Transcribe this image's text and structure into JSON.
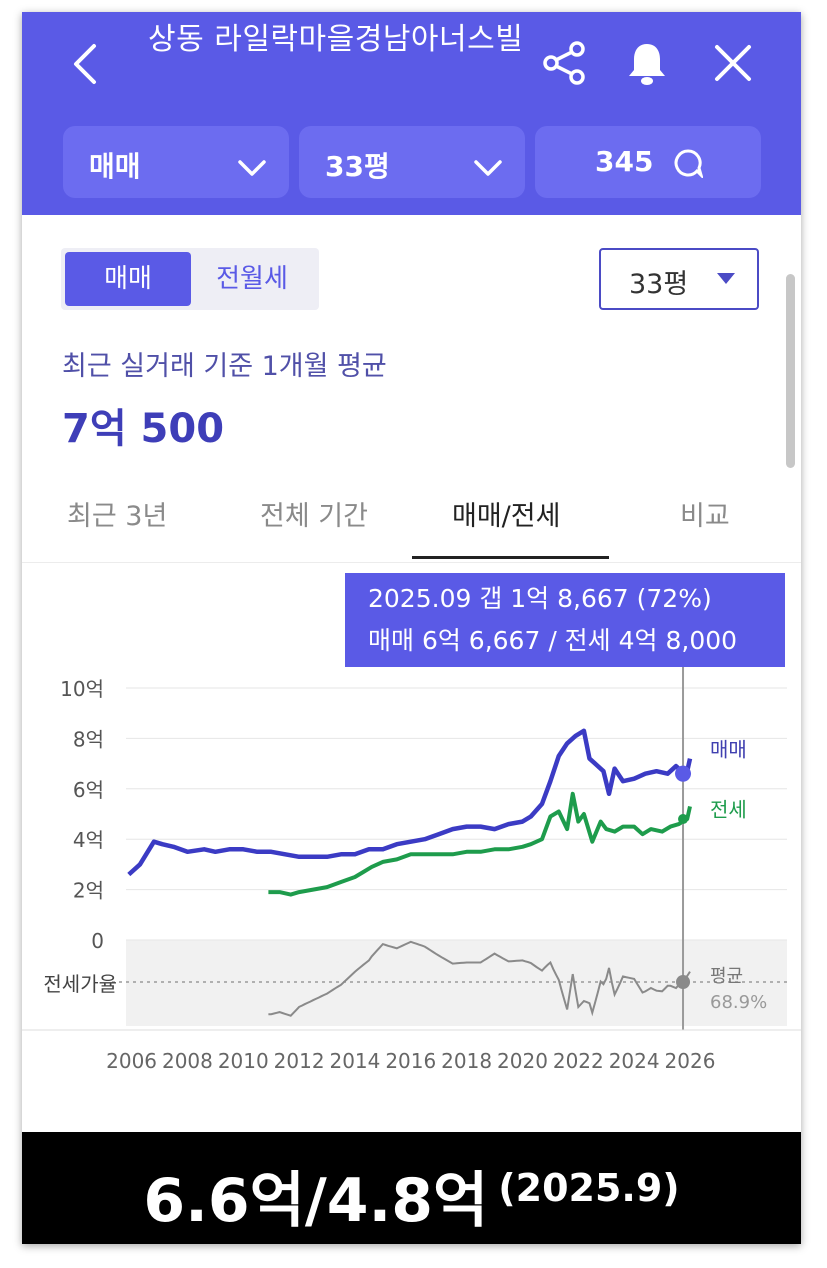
{
  "header": {
    "title": "상동 라일락마을경남아너스빌",
    "deal_type": "매매",
    "area": "33평",
    "comments": "345"
  },
  "icons": {
    "back": "back-arrow-icon",
    "share": "share-icon",
    "bell": "bell-icon",
    "close": "close-icon",
    "chat": "chat-bubble-icon",
    "chevron": "chevron-down-icon"
  },
  "toggle": {
    "active": "매매",
    "inactive": "전월세"
  },
  "area_select": "33평",
  "summary": {
    "subtitle": "최근 실거래 기준 1개월 평균",
    "price": "7억 500"
  },
  "tabs": [
    "최근 3년",
    "전체 기간",
    "매매/전세",
    "비교"
  ],
  "active_tab": "매매/전세",
  "tooltip": {
    "line1": "2025.09  갭 1억 8,667 (72%)",
    "line2": "매매 6억 6,667 / 전세 4억 8,000"
  },
  "colors": {
    "primary": "#5a5ae6",
    "sale": "#3b3bc4",
    "jeonse": "#1e9c4c",
    "ratio": "#8c8c8c"
  },
  "chart_data": {
    "type": "line",
    "ylabel_ticks": [
      "10억",
      "8억",
      "6억",
      "4억",
      "2억",
      "0"
    ],
    "ylim": [
      0,
      10
    ],
    "x_ticks": [
      "2006",
      "2008",
      "2010",
      "2012",
      "2014",
      "2016",
      "2018",
      "2020",
      "2022",
      "2024",
      "2026"
    ],
    "xlim": [
      2005.8,
      2026
    ],
    "series": [
      {
        "name": "매매",
        "x": [
          2005.9,
          2006.3,
          2006.8,
          2007.1,
          2007.5,
          2008.0,
          2008.6,
          2009.0,
          2009.5,
          2010.0,
          2010.5,
          2011.0,
          2011.5,
          2012.0,
          2012.5,
          2013.0,
          2013.5,
          2014.0,
          2014.5,
          2015.0,
          2015.5,
          2016.0,
          2016.5,
          2017.0,
          2017.5,
          2018.0,
          2018.5,
          2019.0,
          2019.5,
          2020.0,
          2020.3,
          2020.7,
          2021.0,
          2021.3,
          2021.6,
          2021.9,
          2022.2,
          2022.4,
          2022.6,
          2022.9,
          2023.1,
          2023.3,
          2023.6,
          2024.0,
          2024.4,
          2024.8,
          2025.2,
          2025.5,
          2025.7,
          2025.9,
          2026.0
        ],
        "values": [
          2.6,
          3.0,
          3.9,
          3.8,
          3.7,
          3.5,
          3.6,
          3.5,
          3.6,
          3.6,
          3.5,
          3.5,
          3.4,
          3.3,
          3.3,
          3.3,
          3.4,
          3.4,
          3.6,
          3.6,
          3.8,
          3.9,
          4.0,
          4.2,
          4.4,
          4.5,
          4.5,
          4.4,
          4.6,
          4.7,
          4.9,
          5.4,
          6.3,
          7.3,
          7.8,
          8.1,
          8.3,
          7.2,
          7.0,
          6.7,
          5.8,
          6.8,
          6.3,
          6.4,
          6.6,
          6.7,
          6.6,
          6.9,
          6.7,
          6.7,
          7.2
        ]
      },
      {
        "name": "전세",
        "x": [
          2010.9,
          2011.3,
          2011.7,
          2012.0,
          2012.5,
          2013.0,
          2013.5,
          2014.0,
          2014.3,
          2014.6,
          2015.0,
          2015.5,
          2016.0,
          2016.5,
          2017.0,
          2017.5,
          2018.0,
          2018.5,
          2019.0,
          2019.5,
          2020.0,
          2020.3,
          2020.7,
          2021.0,
          2021.3,
          2021.6,
          2021.8,
          2022.0,
          2022.2,
          2022.5,
          2022.8,
          2023.0,
          2023.3,
          2023.6,
          2024.0,
          2024.3,
          2024.6,
          2025.0,
          2025.3,
          2025.6,
          2025.9,
          2026.0
        ],
        "values": [
          1.9,
          1.9,
          1.8,
          1.9,
          2.0,
          2.1,
          2.3,
          2.5,
          2.7,
          2.9,
          3.1,
          3.2,
          3.4,
          3.4,
          3.4,
          3.4,
          3.5,
          3.5,
          3.6,
          3.6,
          3.7,
          3.8,
          4.0,
          4.9,
          5.1,
          4.4,
          5.8,
          4.7,
          5.0,
          3.9,
          4.7,
          4.4,
          4.3,
          4.5,
          4.5,
          4.2,
          4.4,
          4.3,
          4.5,
          4.6,
          4.8,
          5.3
        ]
      }
    ],
    "ratio": {
      "label": "전세가율",
      "avg_label": "평균",
      "avg_value": "68.9%"
    },
    "legend": [
      "매매",
      "전세"
    ],
    "legend_placement": "right"
  },
  "caption": {
    "main": "6.6억/4.8억",
    "date": "(2025.9)"
  }
}
